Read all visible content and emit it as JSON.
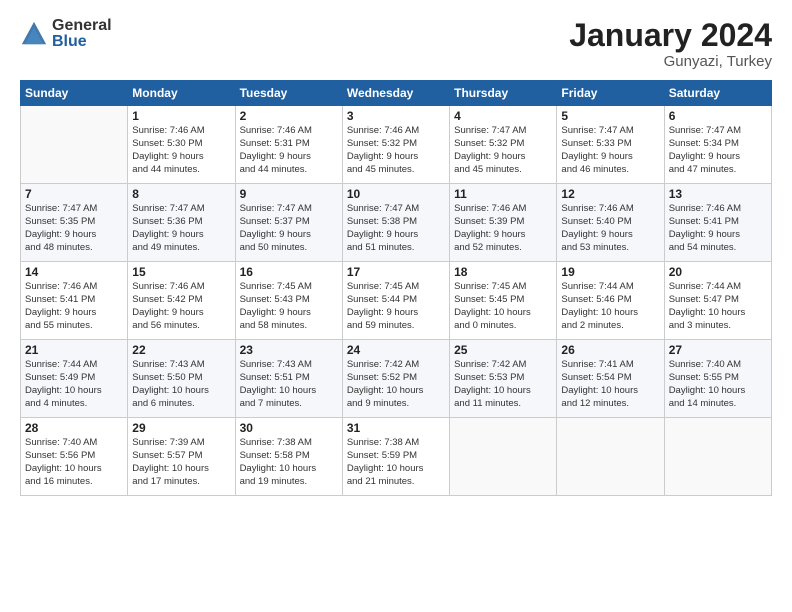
{
  "logo": {
    "general": "General",
    "blue": "Blue"
  },
  "title": "January 2024",
  "subtitle": "Gunyazi, Turkey",
  "headers": [
    "Sunday",
    "Monday",
    "Tuesday",
    "Wednesday",
    "Thursday",
    "Friday",
    "Saturday"
  ],
  "weeks": [
    [
      {
        "day": "",
        "lines": []
      },
      {
        "day": "1",
        "lines": [
          "Sunrise: 7:46 AM",
          "Sunset: 5:30 PM",
          "Daylight: 9 hours",
          "and 44 minutes."
        ]
      },
      {
        "day": "2",
        "lines": [
          "Sunrise: 7:46 AM",
          "Sunset: 5:31 PM",
          "Daylight: 9 hours",
          "and 44 minutes."
        ]
      },
      {
        "day": "3",
        "lines": [
          "Sunrise: 7:46 AM",
          "Sunset: 5:32 PM",
          "Daylight: 9 hours",
          "and 45 minutes."
        ]
      },
      {
        "day": "4",
        "lines": [
          "Sunrise: 7:47 AM",
          "Sunset: 5:32 PM",
          "Daylight: 9 hours",
          "and 45 minutes."
        ]
      },
      {
        "day": "5",
        "lines": [
          "Sunrise: 7:47 AM",
          "Sunset: 5:33 PM",
          "Daylight: 9 hours",
          "and 46 minutes."
        ]
      },
      {
        "day": "6",
        "lines": [
          "Sunrise: 7:47 AM",
          "Sunset: 5:34 PM",
          "Daylight: 9 hours",
          "and 47 minutes."
        ]
      }
    ],
    [
      {
        "day": "7",
        "lines": [
          "Sunrise: 7:47 AM",
          "Sunset: 5:35 PM",
          "Daylight: 9 hours",
          "and 48 minutes."
        ]
      },
      {
        "day": "8",
        "lines": [
          "Sunrise: 7:47 AM",
          "Sunset: 5:36 PM",
          "Daylight: 9 hours",
          "and 49 minutes."
        ]
      },
      {
        "day": "9",
        "lines": [
          "Sunrise: 7:47 AM",
          "Sunset: 5:37 PM",
          "Daylight: 9 hours",
          "and 50 minutes."
        ]
      },
      {
        "day": "10",
        "lines": [
          "Sunrise: 7:47 AM",
          "Sunset: 5:38 PM",
          "Daylight: 9 hours",
          "and 51 minutes."
        ]
      },
      {
        "day": "11",
        "lines": [
          "Sunrise: 7:46 AM",
          "Sunset: 5:39 PM",
          "Daylight: 9 hours",
          "and 52 minutes."
        ]
      },
      {
        "day": "12",
        "lines": [
          "Sunrise: 7:46 AM",
          "Sunset: 5:40 PM",
          "Daylight: 9 hours",
          "and 53 minutes."
        ]
      },
      {
        "day": "13",
        "lines": [
          "Sunrise: 7:46 AM",
          "Sunset: 5:41 PM",
          "Daylight: 9 hours",
          "and 54 minutes."
        ]
      }
    ],
    [
      {
        "day": "14",
        "lines": [
          "Sunrise: 7:46 AM",
          "Sunset: 5:41 PM",
          "Daylight: 9 hours",
          "and 55 minutes."
        ]
      },
      {
        "day": "15",
        "lines": [
          "Sunrise: 7:46 AM",
          "Sunset: 5:42 PM",
          "Daylight: 9 hours",
          "and 56 minutes."
        ]
      },
      {
        "day": "16",
        "lines": [
          "Sunrise: 7:45 AM",
          "Sunset: 5:43 PM",
          "Daylight: 9 hours",
          "and 58 minutes."
        ]
      },
      {
        "day": "17",
        "lines": [
          "Sunrise: 7:45 AM",
          "Sunset: 5:44 PM",
          "Daylight: 9 hours",
          "and 59 minutes."
        ]
      },
      {
        "day": "18",
        "lines": [
          "Sunrise: 7:45 AM",
          "Sunset: 5:45 PM",
          "Daylight: 10 hours",
          "and 0 minutes."
        ]
      },
      {
        "day": "19",
        "lines": [
          "Sunrise: 7:44 AM",
          "Sunset: 5:46 PM",
          "Daylight: 10 hours",
          "and 2 minutes."
        ]
      },
      {
        "day": "20",
        "lines": [
          "Sunrise: 7:44 AM",
          "Sunset: 5:47 PM",
          "Daylight: 10 hours",
          "and 3 minutes."
        ]
      }
    ],
    [
      {
        "day": "21",
        "lines": [
          "Sunrise: 7:44 AM",
          "Sunset: 5:49 PM",
          "Daylight: 10 hours",
          "and 4 minutes."
        ]
      },
      {
        "day": "22",
        "lines": [
          "Sunrise: 7:43 AM",
          "Sunset: 5:50 PM",
          "Daylight: 10 hours",
          "and 6 minutes."
        ]
      },
      {
        "day": "23",
        "lines": [
          "Sunrise: 7:43 AM",
          "Sunset: 5:51 PM",
          "Daylight: 10 hours",
          "and 7 minutes."
        ]
      },
      {
        "day": "24",
        "lines": [
          "Sunrise: 7:42 AM",
          "Sunset: 5:52 PM",
          "Daylight: 10 hours",
          "and 9 minutes."
        ]
      },
      {
        "day": "25",
        "lines": [
          "Sunrise: 7:42 AM",
          "Sunset: 5:53 PM",
          "Daylight: 10 hours",
          "and 11 minutes."
        ]
      },
      {
        "day": "26",
        "lines": [
          "Sunrise: 7:41 AM",
          "Sunset: 5:54 PM",
          "Daylight: 10 hours",
          "and 12 minutes."
        ]
      },
      {
        "day": "27",
        "lines": [
          "Sunrise: 7:40 AM",
          "Sunset: 5:55 PM",
          "Daylight: 10 hours",
          "and 14 minutes."
        ]
      }
    ],
    [
      {
        "day": "28",
        "lines": [
          "Sunrise: 7:40 AM",
          "Sunset: 5:56 PM",
          "Daylight: 10 hours",
          "and 16 minutes."
        ]
      },
      {
        "day": "29",
        "lines": [
          "Sunrise: 7:39 AM",
          "Sunset: 5:57 PM",
          "Daylight: 10 hours",
          "and 17 minutes."
        ]
      },
      {
        "day": "30",
        "lines": [
          "Sunrise: 7:38 AM",
          "Sunset: 5:58 PM",
          "Daylight: 10 hours",
          "and 19 minutes."
        ]
      },
      {
        "day": "31",
        "lines": [
          "Sunrise: 7:38 AM",
          "Sunset: 5:59 PM",
          "Daylight: 10 hours",
          "and 21 minutes."
        ]
      },
      {
        "day": "",
        "lines": []
      },
      {
        "day": "",
        "lines": []
      },
      {
        "day": "",
        "lines": []
      }
    ]
  ]
}
